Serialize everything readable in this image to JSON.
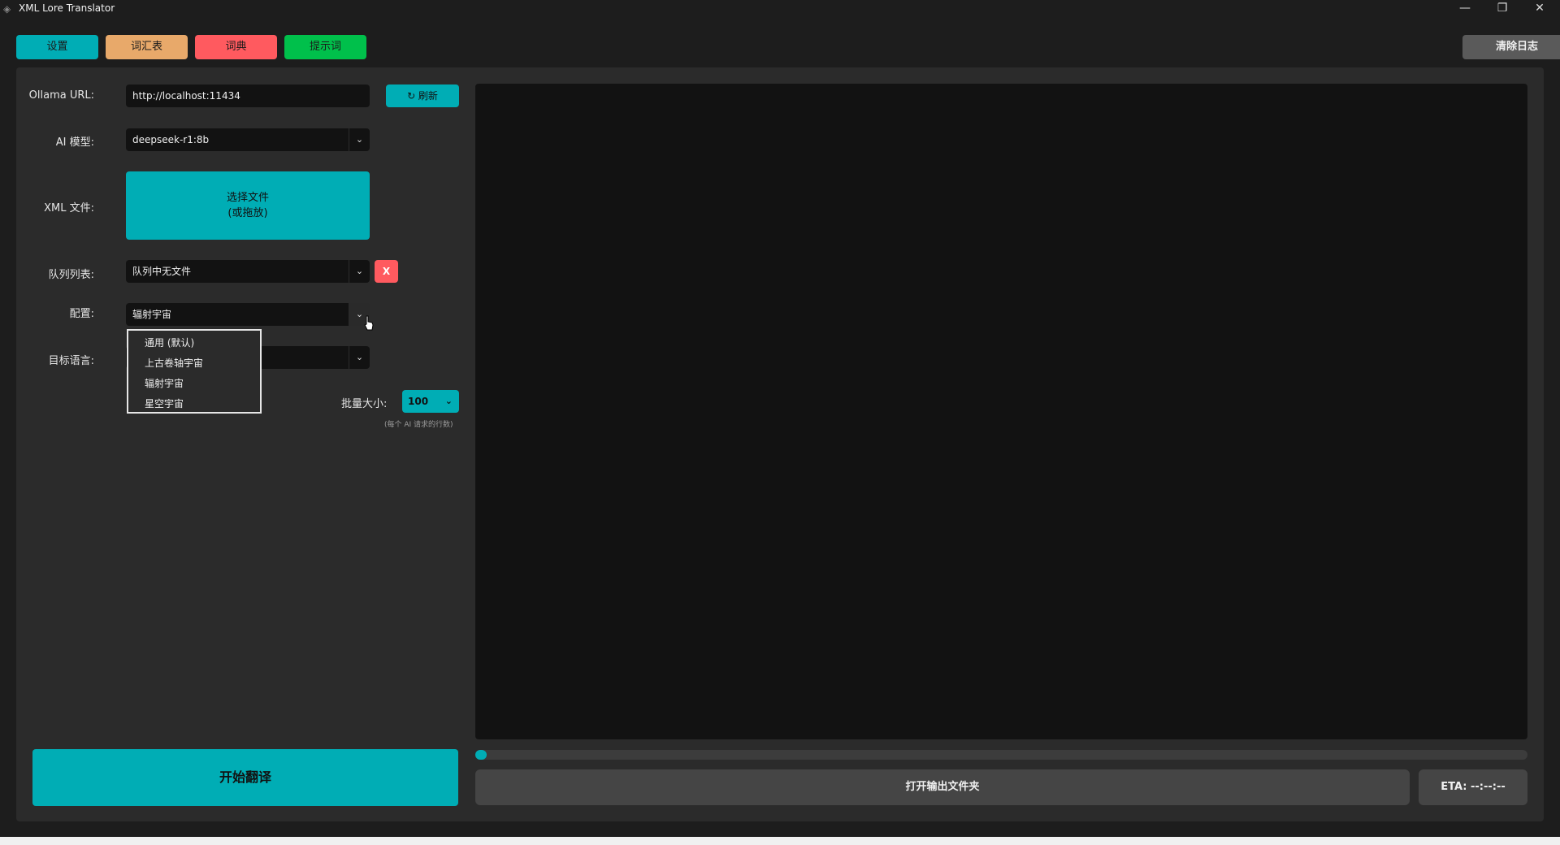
{
  "window": {
    "title": "XML Lore Translator",
    "minimize": "—",
    "restore": "❐",
    "close": "✕"
  },
  "top_buttons": [
    {
      "label": "设置",
      "color": "#00adb5"
    },
    {
      "label": "词汇表",
      "color": "#e8a96a"
    },
    {
      "label": "词典",
      "color": "#ff5a5f"
    },
    {
      "label": "提示词",
      "color": "#00c04b"
    }
  ],
  "clear_log": "清除日志",
  "form": {
    "ollama_label": "Ollama URL:",
    "ollama_value": "http://localhost:11434",
    "refresh_label": "↻ 刷新",
    "model_label": "AI 模型:",
    "model_value": "deepseek-r1:8b",
    "xml_label": "XML 文件:",
    "choose_file_line1": "选择文件",
    "choose_file_line2": "(或拖放)",
    "queue_label": "队列列表:",
    "queue_value": "队列中无文件",
    "queue_clear": "X",
    "config_label": "配置:",
    "config_value": "辐射宇宙",
    "target_lang_label": "目标语言:",
    "batch_label": "批量大小:",
    "batch_value": "100",
    "batch_hint": "(每个 AI 请求的行数)"
  },
  "config_options": [
    "通用 (默认)",
    "上古卷轴宇宙",
    "辐射宇宙",
    "星空宇宙"
  ],
  "progress": 0.01,
  "open_folder": "打开输出文件夹",
  "eta": "ETA: --:--:--",
  "start": "开始翻译"
}
